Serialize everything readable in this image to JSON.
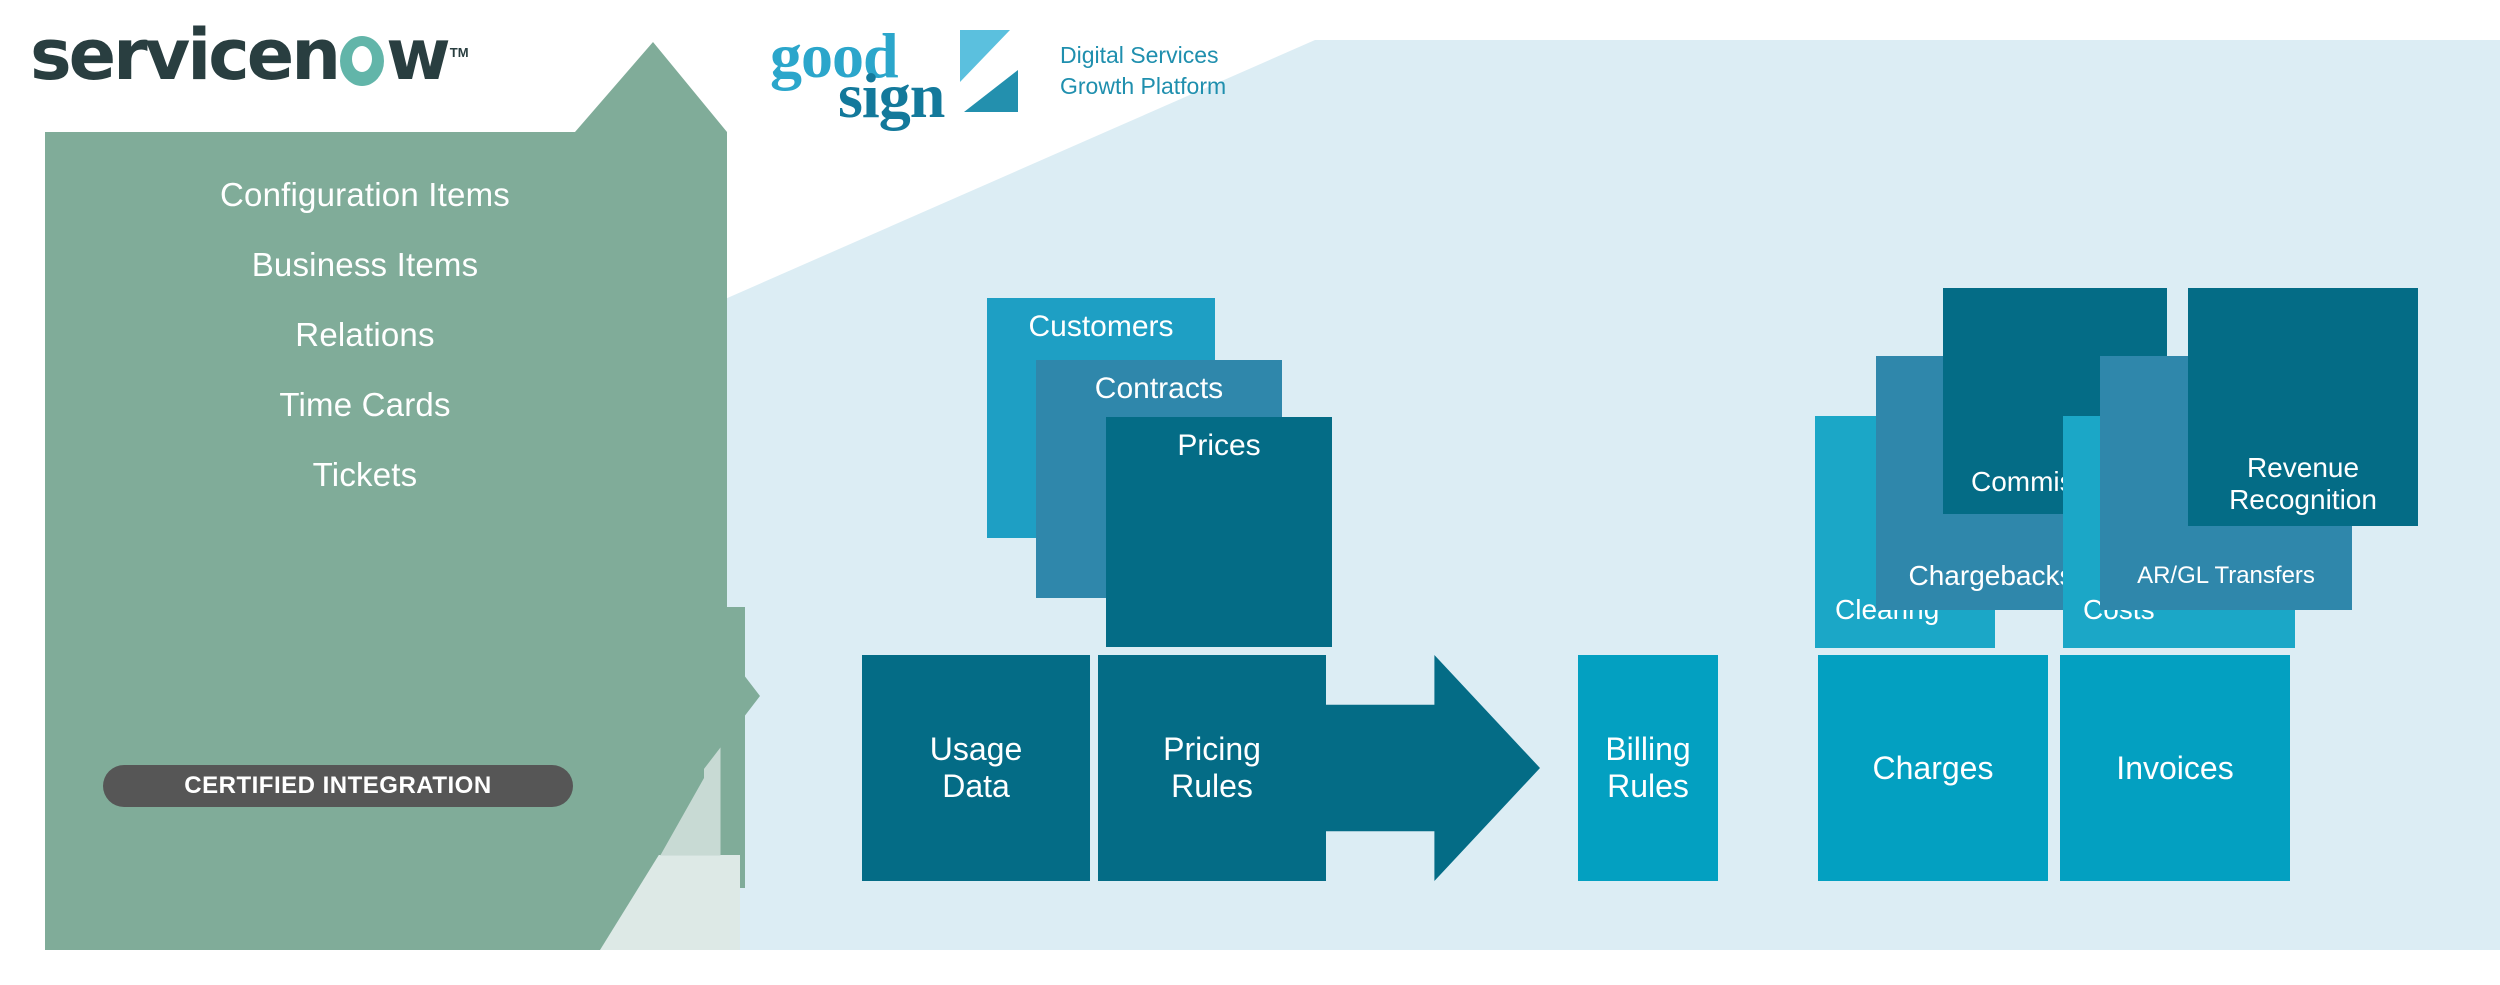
{
  "brand": {
    "servicenow": {
      "text_before": "servicen",
      "o_glyph": "o-ring-icon",
      "text_after": "w",
      "trademark": "TM"
    },
    "goodsign": {
      "word_top": "good",
      "word_bottom": "sign",
      "tagline_line1": "Digital Services",
      "tagline_line2": "Growth Platform"
    }
  },
  "sidebar": {
    "items": [
      {
        "label": "Configuration Items"
      },
      {
        "label": "Business Items"
      },
      {
        "label": "Relations"
      },
      {
        "label": "Time Cards"
      },
      {
        "label": "Tickets"
      }
    ],
    "badge": "CERTIFIED INTEGRATION"
  },
  "input_stack": {
    "cards": [
      {
        "label": "Customers",
        "color": "#1e9fc4"
      },
      {
        "label": "Contracts",
        "color": "#2f87ab"
      },
      {
        "label": "Prices",
        "color": "#046c86"
      }
    ]
  },
  "input_row": {
    "cards": [
      {
        "label": "Usage\nData",
        "line1": "Usage",
        "line2": "Data",
        "color": "#046c86"
      },
      {
        "label": "Pricing\nRules",
        "line1": "Pricing",
        "line2": "Rules",
        "color": "#046c86"
      }
    ]
  },
  "flow_arrow": {
    "name": "process-arrow",
    "color": "#046c86",
    "direction": "right"
  },
  "green_arrow": {
    "name": "integration-arrow",
    "color": "#80ac99",
    "direction": "right"
  },
  "output_stack": {
    "cards": [
      {
        "label": "Clearing",
        "color": "#1ba7c7"
      },
      {
        "label": "Chargebacks",
        "color": "#2f87ab"
      },
      {
        "label": "Commissions",
        "color": "#046c86"
      },
      {
        "label": "Costs",
        "color": "#1ba7c7"
      },
      {
        "label": "AR/GL Transfers",
        "color": "#2f87ab"
      },
      {
        "label": "Revenue Recognition",
        "line1": "Revenue",
        "line2": "Recognition",
        "color": "#046c86"
      }
    ]
  },
  "output_row": {
    "cards": [
      {
        "label": "Billing Rules",
        "line1": "Billing",
        "line2": "Rules",
        "color": "#03a0c1"
      },
      {
        "label": "Charges",
        "color": "#03a0c1"
      },
      {
        "label": "Invoices",
        "color": "#03a0c1"
      }
    ]
  },
  "colors": {
    "panel_green": "#80ac99",
    "panel_blue": "#dcedf4",
    "teal_dark": "#046c86",
    "teal_mid": "#2f87ab",
    "teal_bright": "#1ba7c7",
    "teal_light": "#03a0c1",
    "badge_gray": "#565656",
    "servicenow_navy": "#293e40",
    "goodsign_blue": "#2ba6cb"
  }
}
